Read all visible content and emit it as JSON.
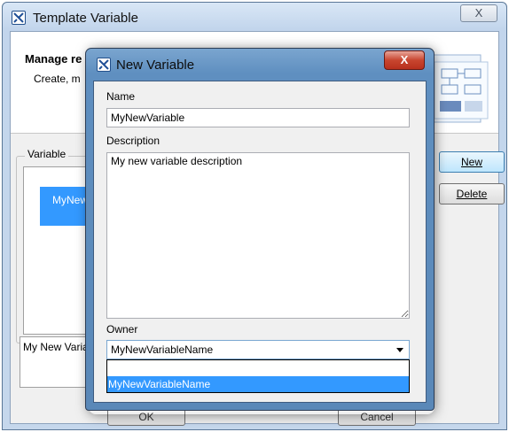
{
  "outer_window": {
    "title": "Template Variable",
    "close_label": "X",
    "header_title": "Manage re",
    "header_subtitle": "Create, m",
    "group_label": "Variable",
    "list_items": [
      "MyNewVa"
    ],
    "description_preview": "My New Varia",
    "buttons": {
      "new": "New",
      "delete": "Delete",
      "ok": "OK",
      "cancel": "Cancel"
    }
  },
  "modal": {
    "title": "New Variable",
    "close_label": "X",
    "name_label": "Name",
    "name_value": "MyNewVariable",
    "description_label": "Description",
    "description_value": "My new variable description",
    "owner_label": "Owner",
    "owner_value": "MyNewVariableName",
    "owner_options": [
      "",
      "MyNewVariableName"
    ]
  },
  "colors": {
    "selection": "#3399ff",
    "modal_titlebar": "#5f8fc0",
    "close_button": "#c8452f"
  },
  "icons": [
    "app-icon",
    "document-diagram-icon",
    "dropdown-arrow-icon"
  ]
}
